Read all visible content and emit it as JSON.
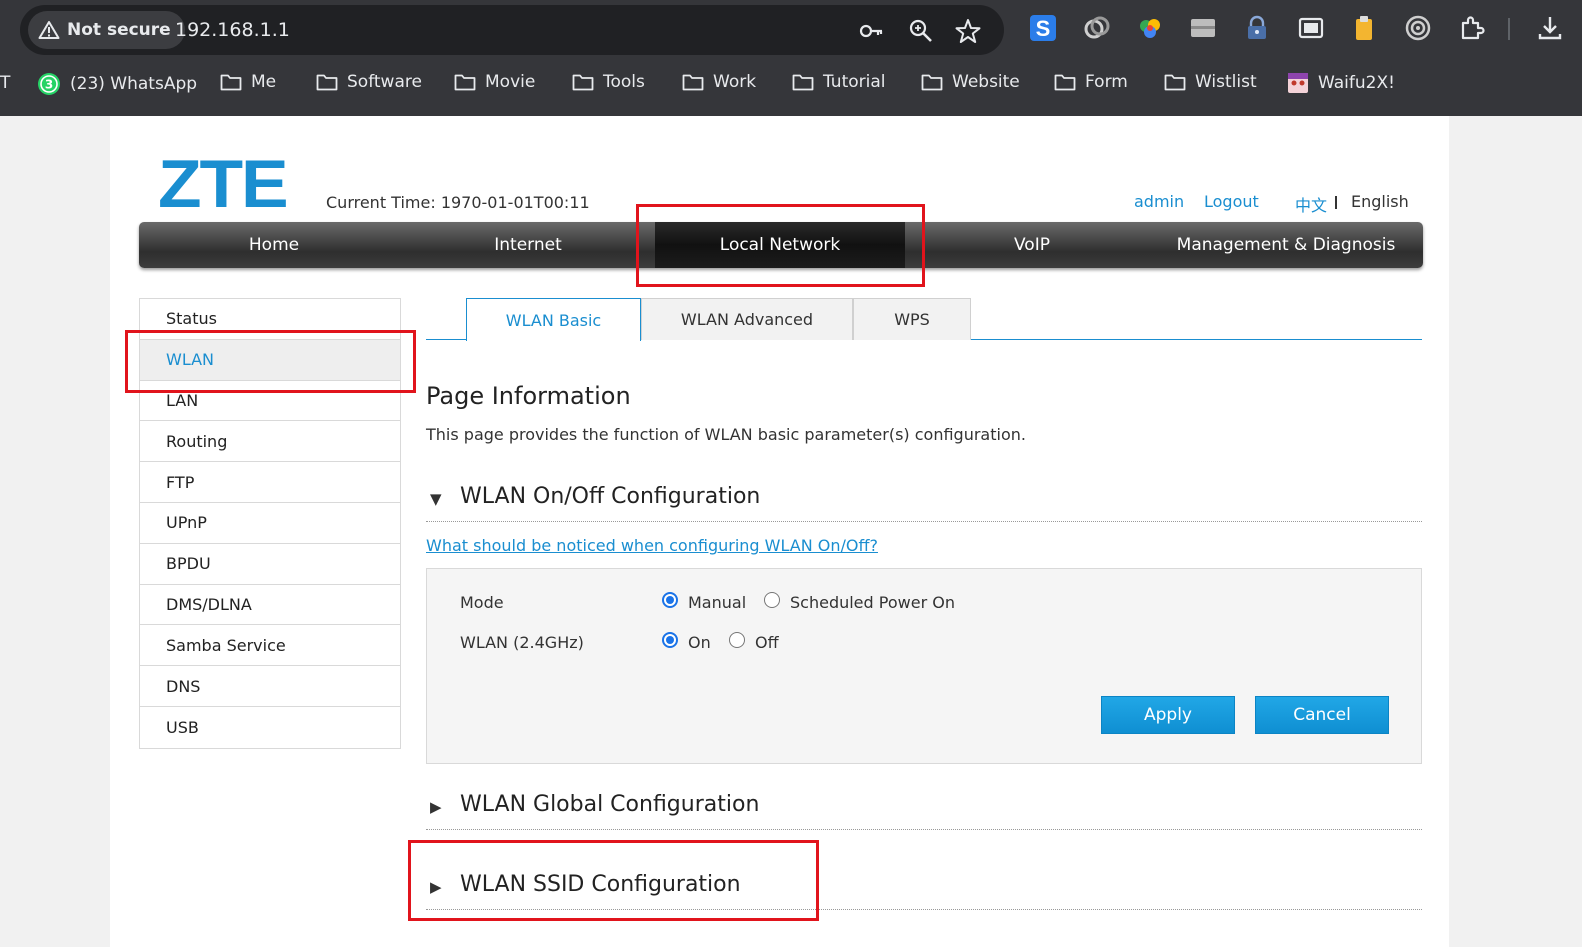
{
  "browser": {
    "security_label": "Not secure",
    "url": "192.168.1.1",
    "bookmarks_cut": "T",
    "bookmarks": [
      {
        "label": "(23) WhatsApp",
        "icon": "whatsapp-icon"
      },
      {
        "label": "Me",
        "icon": "folder-icon"
      },
      {
        "label": "Software",
        "icon": "folder-icon"
      },
      {
        "label": "Movie",
        "icon": "folder-icon"
      },
      {
        "label": "Tools",
        "icon": "folder-icon"
      },
      {
        "label": "Work",
        "icon": "folder-icon"
      },
      {
        "label": "Tutorial",
        "icon": "folder-icon"
      },
      {
        "label": "Website",
        "icon": "folder-icon"
      },
      {
        "label": "Form",
        "icon": "folder-icon"
      },
      {
        "label": "Wistlist",
        "icon": "folder-icon"
      },
      {
        "label": "Waifu2X!",
        "icon": "waifu-icon"
      }
    ],
    "whatsapp_badge": "3"
  },
  "header": {
    "logo": "ZTE",
    "current_time": "Current Time: 1970-01-01T00:11",
    "user": "admin",
    "logout": "Logout",
    "lang_chinese": "中文",
    "lang_english": "English"
  },
  "nav": {
    "items": [
      "Home",
      "Internet",
      "Local Network",
      "VoIP",
      "Management & Diagnosis"
    ],
    "active": "Local Network"
  },
  "sidebar": {
    "items": [
      "Status",
      "WLAN",
      "LAN",
      "Routing",
      "FTP",
      "UPnP",
      "BPDU",
      "DMS/DLNA",
      "Samba Service",
      "DNS",
      "USB"
    ],
    "active": "WLAN"
  },
  "tabs": {
    "items": [
      "WLAN Basic",
      "WLAN Advanced",
      "WPS"
    ],
    "active": "WLAN Basic"
  },
  "content": {
    "page_info_title": "Page Information",
    "page_info_desc": "This page provides the function of WLAN basic parameter(s) configuration.",
    "section_onoff": "WLAN On/Off Configuration",
    "notice_link": "What should be noticed when configuring WLAN On/Off?",
    "mode_label": "Mode",
    "mode_options": [
      "Manual",
      "Scheduled Power On"
    ],
    "mode_selected": "Manual",
    "wlan_label": "WLAN (2.4GHz)",
    "wlan_options": [
      "On",
      "Off"
    ],
    "wlan_selected": "On",
    "apply": "Apply",
    "cancel": "Cancel",
    "section_global": "WLAN Global Configuration",
    "section_ssid": "WLAN SSID Configuration"
  },
  "colors": {
    "accent": "#1a8ed0",
    "highlight_box": "#e1141c",
    "chrome_bg": "#35363a"
  }
}
